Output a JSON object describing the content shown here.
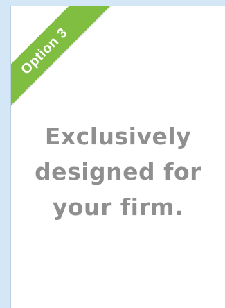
{
  "ribbon": {
    "label": "Option 3",
    "color": "#80be41"
  },
  "message": {
    "lines": [
      "Exclusively",
      "designed for",
      "your firm."
    ],
    "color": "#8f8f8f"
  },
  "background_color": "#d3e7f6",
  "card_color": "#ffffff"
}
